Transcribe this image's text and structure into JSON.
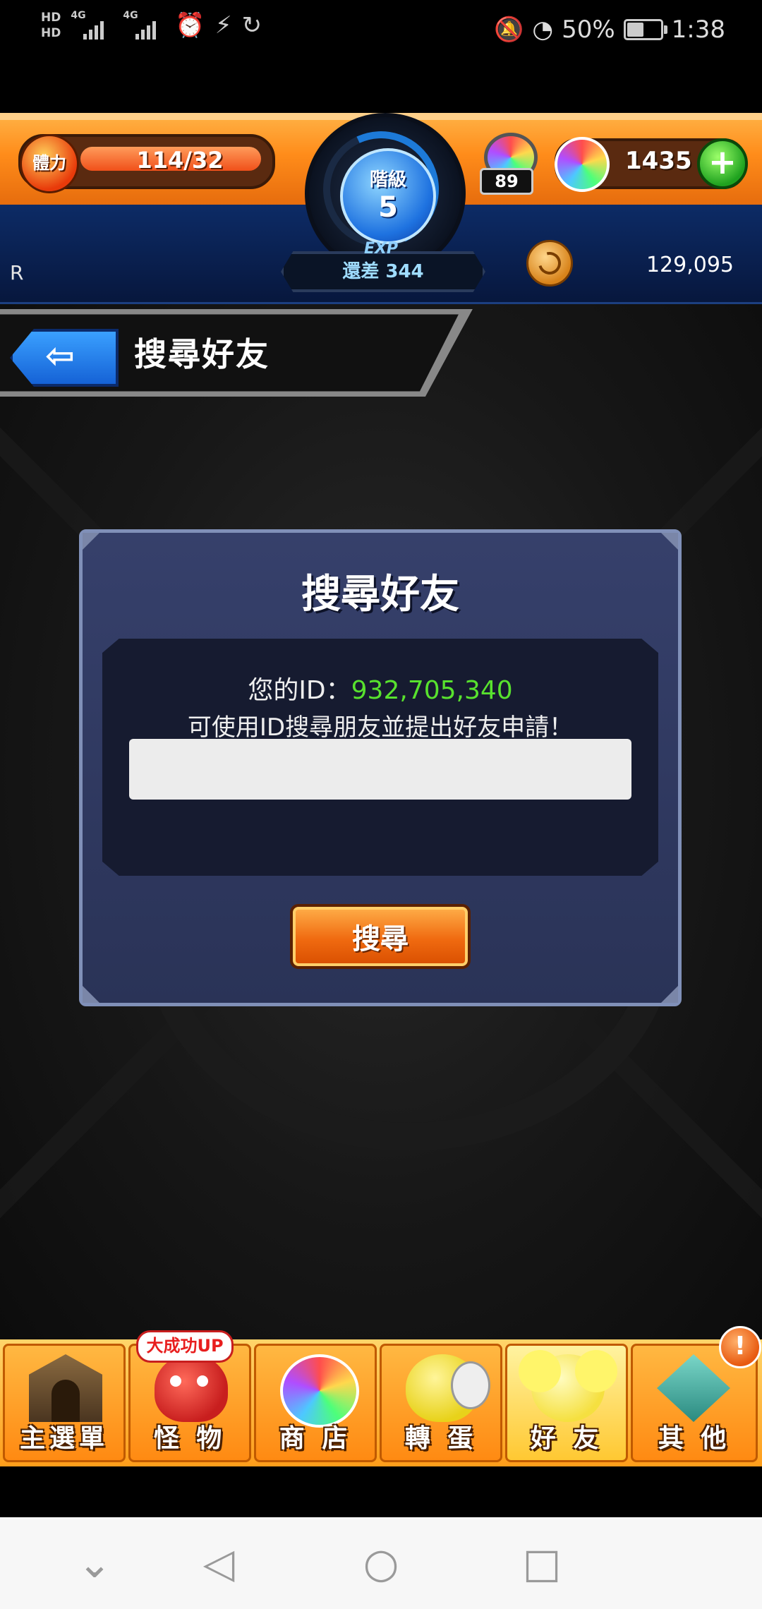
{
  "status_bar": {
    "hd1": "HD",
    "hd2": "HD",
    "net1": "4G",
    "net2": "4G",
    "battery_percent": "50%",
    "battery_level": 0.5,
    "time": "1:38",
    "icons": [
      "signal-icon",
      "alarm-icon",
      "flash-icon",
      "sync-icon",
      "mute-icon",
      "speed-icon",
      "battery-icon"
    ]
  },
  "game_header": {
    "stamina_label": "體力",
    "stamina_value": "114/32",
    "rank_label": "階級",
    "rank_value": "5",
    "exp_label": "EXP",
    "exp_remaining": "還差 344",
    "potion_count": "89",
    "orb_count": "1435",
    "add_label": "+",
    "left_label": "R",
    "gold_value": "129,095"
  },
  "page": {
    "title": "搜尋好友",
    "back_arrow": "⇦"
  },
  "dialog": {
    "title": "搜尋好友",
    "id_prefix": "您的ID：",
    "id_value": "932,705,340",
    "hint": "可使用ID搜尋朋友並提出好友申請！",
    "input_value": "",
    "search_button": "搜尋"
  },
  "bottom_nav": {
    "items": [
      {
        "label": "主選單",
        "icon": "gate-icon"
      },
      {
        "label": "怪 物",
        "icon": "monster-icon",
        "badge": "大成功UP"
      },
      {
        "label": "商 店",
        "icon": "orb-icon"
      },
      {
        "label": "轉 蛋",
        "icon": "egg-icon"
      },
      {
        "label": "好 友",
        "icon": "friends-icon"
      },
      {
        "label": "其 他",
        "icon": "other-icon",
        "badge": "!"
      }
    ],
    "active_index": 4
  },
  "system_nav": {
    "down": "⌄",
    "back": "◁",
    "home": "○",
    "recent": "□"
  },
  "colors": {
    "header_orange": "#ff8c1a",
    "header_blue": "#0d2b66",
    "dialog_bg": "#36406b",
    "id_green": "#58e22e",
    "button_orange": "#f06a10"
  }
}
